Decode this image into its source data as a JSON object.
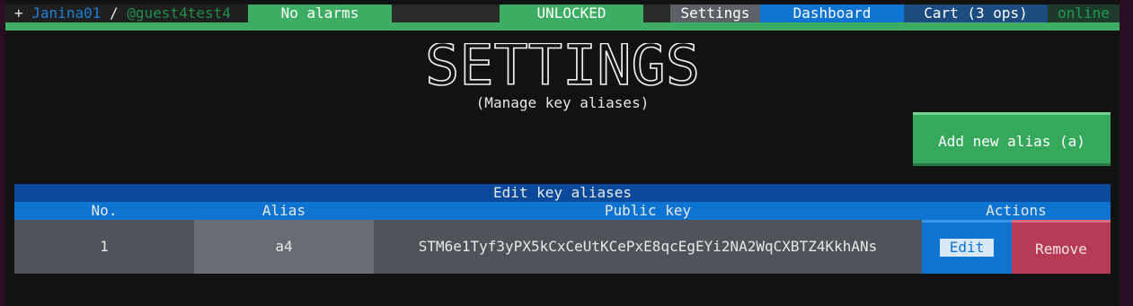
{
  "header": {
    "plus": "+",
    "username": "Janina01",
    "separator": "/",
    "account": "@guest4test4",
    "alarms": "No alarms",
    "lock_status": "UNLOCKED",
    "tabs": {
      "settings": "Settings",
      "dashboard": "Dashboard",
      "cart": "Cart (3 ops)"
    },
    "connection": "online"
  },
  "page": {
    "title": "SETTINGS",
    "subtitle": "(Manage key aliases)",
    "add_button": "Add new alias (a)"
  },
  "table": {
    "title": "Edit key aliases",
    "columns": [
      "No.",
      "Alias",
      "Public key",
      "Actions"
    ],
    "rows": [
      {
        "no": "1",
        "alias": "a4",
        "public_key": "STM6e1Tyf3yPX5kCxCeUtKCePxE8qcEgEYi2NA2WqCXBTZ4KkhANs",
        "edit": "Edit",
        "remove": "Remove"
      }
    ]
  },
  "colors": {
    "green": "#3cad62",
    "blue": "#0d74d2",
    "dark_blue": "#0b4a9a",
    "red": "#b63b55",
    "background": "#121212"
  }
}
